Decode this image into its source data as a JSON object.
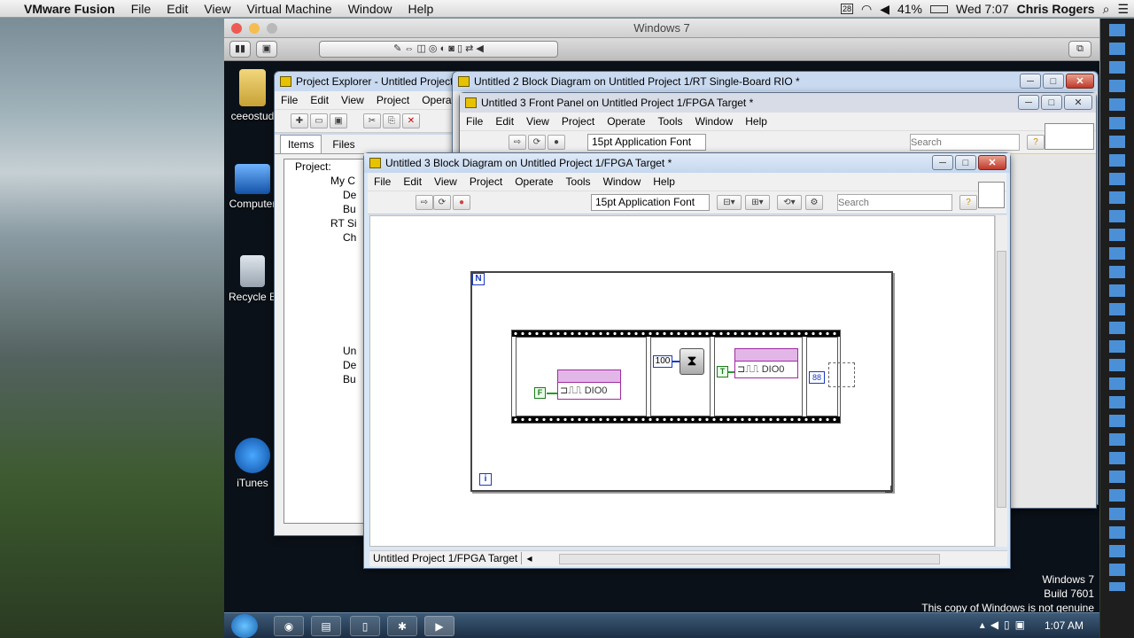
{
  "mac_menubar": {
    "apple": "",
    "app": "VMware Fusion",
    "items": [
      "File",
      "Edit",
      "View",
      "Virtual Machine",
      "Window",
      "Help"
    ],
    "status": {
      "battery": "41%",
      "datetime": "Wed 7:07",
      "user": "Chris Rogers"
    }
  },
  "vmware": {
    "title": "Windows 7"
  },
  "desktop_icons": [
    {
      "label": "ceeostud"
    },
    {
      "label": "Computer"
    },
    {
      "label": "Recycle B"
    },
    {
      "label": "iTunes"
    }
  ],
  "project_explorer": {
    "title": "Project Explorer - Untitled Project",
    "menu": [
      "File",
      "Edit",
      "View",
      "Project",
      "Operate"
    ],
    "tabs": [
      "Items",
      "Files"
    ],
    "tree": [
      "Project:",
      "My C",
      "De",
      "Bu",
      "RT Si",
      "Ch",
      "",
      "",
      "",
      "",
      "",
      "",
      "Un",
      "De",
      "Bu"
    ]
  },
  "block_diagram2": {
    "title": "Untitled 2 Block Diagram on Untitled Project 1/RT Single-Board RIO *"
  },
  "front_panel3": {
    "title": "Untitled 3 Front Panel on Untitled Project 1/FPGA Target *",
    "menu": [
      "File",
      "Edit",
      "View",
      "Project",
      "Operate",
      "Tools",
      "Window",
      "Help"
    ],
    "font": "15pt Application Font",
    "search_placeholder": "Search"
  },
  "block_diagram3": {
    "title": "Untitled 3 Block Diagram on Untitled Project 1/FPGA Target *",
    "menu": [
      "File",
      "Edit",
      "View",
      "Project",
      "Operate",
      "Tools",
      "Window",
      "Help"
    ],
    "font": "15pt Application Font",
    "search_placeholder": "Search",
    "status_path": "Untitled Project 1/FPGA Target",
    "loop_count_label": "N",
    "loop_iter_label": "i",
    "nodes": [
      {
        "io_label": "DIO0"
      },
      {
        "io_label": "DIO0"
      }
    ],
    "constants": {
      "false_const": "F",
      "true_const": "T",
      "wait_ms": "100"
    }
  },
  "watermark": {
    "line1": "Windows 7",
    "line2": "Build 7601",
    "line3": "This copy of Windows is not genuine"
  },
  "taskbar": {
    "clock": "1:07 AM"
  }
}
